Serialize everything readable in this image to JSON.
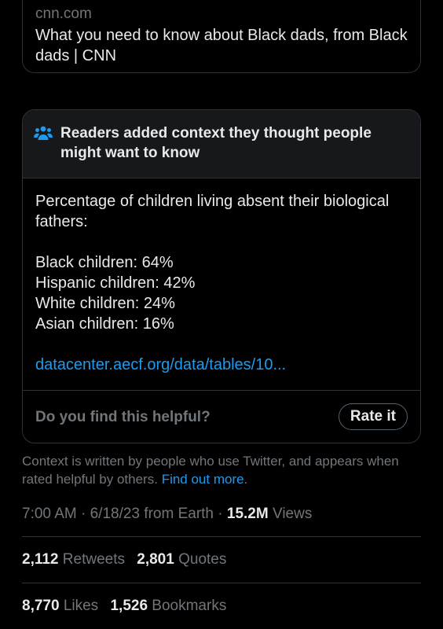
{
  "link_card": {
    "domain": "cnn.com",
    "title": "What you need to know about Black dads, from Black dads | CNN"
  },
  "note": {
    "header": "Readers added context they thought people might want to know",
    "header_icon": "community-notes-people-icon",
    "intro": "Percentage of children living absent their biological fathers:",
    "stats": [
      "Black children: 64%",
      "Hispanic children: 42%",
      "White children: 24%",
      "Asian children: 16%"
    ],
    "link": "datacenter.aecf.org/data/tables/10...",
    "helpful_question": "Do you find this helpful?",
    "rate_button": "Rate it"
  },
  "context_footer": {
    "text": "Context is written by people who use Twitter, and appears when rated helpful by others.",
    "link": "Find out more",
    "link_suffix": "."
  },
  "meta": {
    "time": "7:00 AM",
    "date": "6/18/23",
    "source": "from Earth",
    "views_count": "15.2M",
    "views_label": "Views"
  },
  "engagement": {
    "retweets_count": "2,112",
    "retweets_label": "Retweets",
    "quotes_count": "2,801",
    "quotes_label": "Quotes",
    "likes_count": "8,770",
    "likes_label": "Likes",
    "bookmarks_count": "1,526",
    "bookmarks_label": "Bookmarks"
  },
  "colors": {
    "background": "#000000",
    "text": "#e7e9ea",
    "secondary_text": "#71767b",
    "link": "#1d9bf0",
    "border": "#2f3336",
    "note_header_bg": "#16181c"
  }
}
